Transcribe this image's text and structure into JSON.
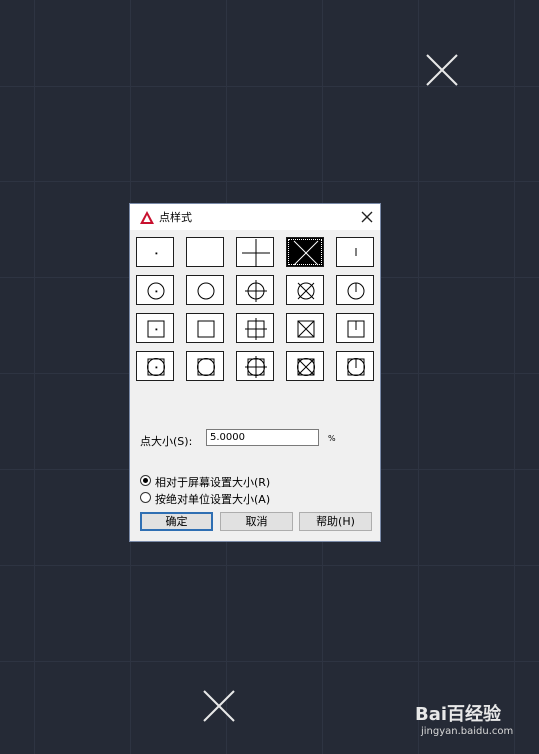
{
  "dialog": {
    "title": "点样式",
    "size_label": "点大小(S):",
    "size_value": "5.0000",
    "unit": "%",
    "radio_relative": "相对于屏幕设置大小(R)",
    "radio_absolute": "按绝对单位设置大小(A)",
    "selected_mode": "relative",
    "ok_label": "确定",
    "cancel_label": "取消",
    "help_label": "帮助(H)",
    "selected_style": 3
  },
  "point_styles": [
    {
      "shape": "dot"
    },
    {
      "shape": "none"
    },
    {
      "shape": "plus"
    },
    {
      "shape": "x"
    },
    {
      "shape": "tick"
    },
    {
      "shape": "circle-dot"
    },
    {
      "shape": "circle"
    },
    {
      "shape": "circle-plus"
    },
    {
      "shape": "circle-x"
    },
    {
      "shape": "circle-tick"
    },
    {
      "shape": "square-dot"
    },
    {
      "shape": "square"
    },
    {
      "shape": "square-plus"
    },
    {
      "shape": "square-x"
    },
    {
      "shape": "square-tick"
    },
    {
      "shape": "sqcirc-dot"
    },
    {
      "shape": "sqcirc"
    },
    {
      "shape": "sqcirc-plus"
    },
    {
      "shape": "sqcirc-x"
    },
    {
      "shape": "sqcirc-tick"
    }
  ],
  "colors": {
    "canvas": "#252a36",
    "grid": "#2e3442",
    "marker": "#e8e8e8",
    "default_button_border": "#2f6fb3"
  },
  "watermark": {
    "brand": "Bai百经验",
    "url": "jingyan.baidu.com"
  }
}
